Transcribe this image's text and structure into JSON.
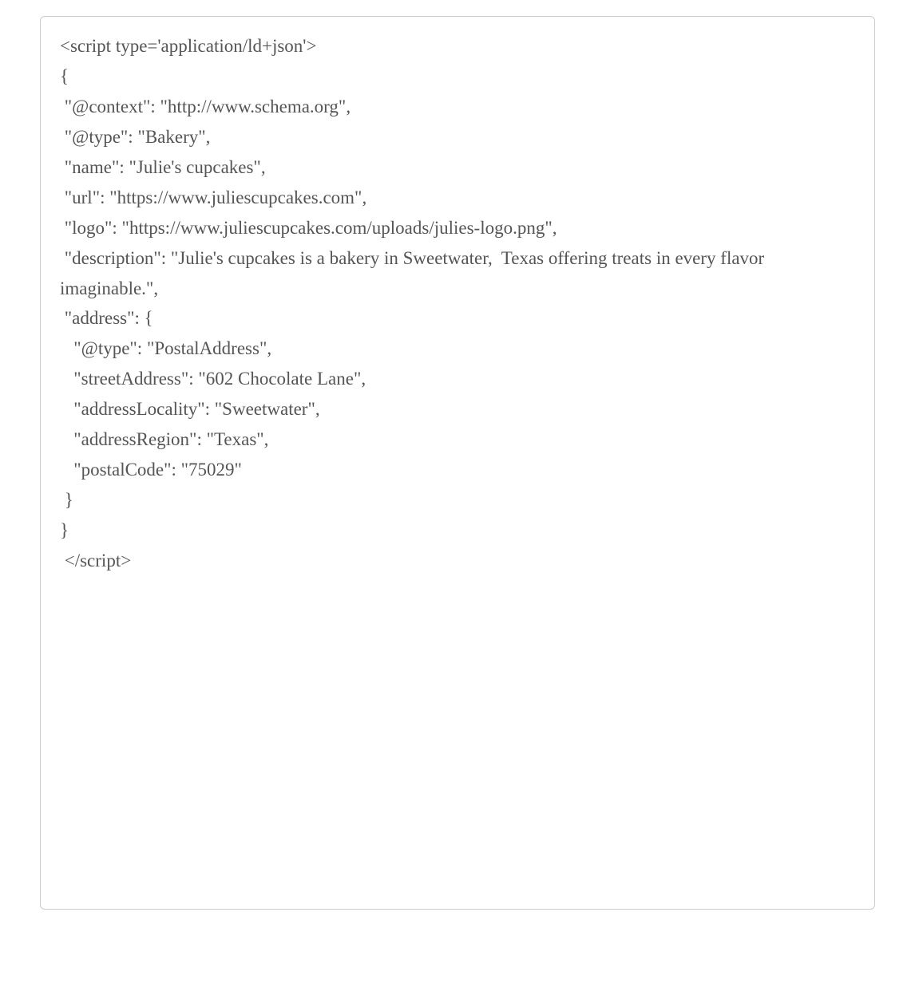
{
  "code": {
    "line01": "<script type='application/ld+json'>",
    "line02": "{",
    "line03": " \"@context\": \"http://www.schema.org\",",
    "line04": " \"@type\": \"Bakery\",",
    "line05": " \"name\": \"Julie's cupcakes\",",
    "line06": " \"url\": \"https://www.juliescupcakes.com\",",
    "line07": " \"logo\": \"https://www.juliescupcakes.com/uploads/julies-logo.png\",",
    "line08": " \"description\": \"Julie's cupcakes is a bakery in Sweetwater,  Texas offering treats in every flavor imaginable.\",",
    "line09": " \"address\": {",
    "line10": "   \"@type\": \"PostalAddress\",",
    "line11": "   \"streetAddress\": \"602 Chocolate Lane\",",
    "line12": "   \"addressLocality\": \"Sweetwater\",",
    "line13": "   \"addressRegion\": \"Texas\",",
    "line14": "   \"postalCode\": \"75029\"",
    "line15": " }",
    "line16": "}",
    "line17": " </script>"
  }
}
